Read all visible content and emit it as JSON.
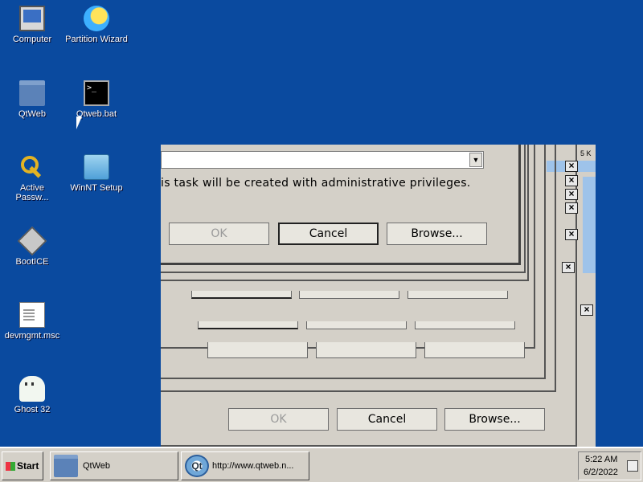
{
  "desktop_icons": [
    {
      "label": "Computer",
      "icon": "computer-icon"
    },
    {
      "label": "Partition Wizard",
      "icon": "partition-wizard-icon"
    },
    {
      "label": "QtWeb",
      "icon": "folder-icon"
    },
    {
      "label": "Qtweb.bat",
      "icon": "batch-file-icon"
    },
    {
      "label": "Active Passw...",
      "icon": "key-icon"
    },
    {
      "label": "WinNT Setup",
      "icon": "setup-icon"
    },
    {
      "label": "BootICE",
      "icon": "bootice-icon"
    },
    {
      "label": "devmgmt.msc",
      "icon": "document-icon"
    },
    {
      "label": "Ghost 32",
      "icon": "ghost-icon"
    }
  ],
  "dialog": {
    "message": "is task will be created with administrative privileges.",
    "ok_label": "OK",
    "cancel_label": "Cancel",
    "browse_label": "Browse...",
    "right_fragment": "5 K",
    "close_glyph": "×",
    "dropdown_glyph": "▼"
  },
  "taskbar": {
    "start_label": "Start",
    "tasks": [
      {
        "label": "QtWeb",
        "icon": "folder-icon"
      },
      {
        "label": "http://www.qtweb.n...",
        "icon": "qt-browser-icon"
      }
    ],
    "time": "5:22 AM",
    "date": "6/2/2022"
  },
  "colors": {
    "desktop": "#0a4a9f",
    "dialog_face": "#d4d0c8",
    "taskbar": "#d4d0c8"
  }
}
